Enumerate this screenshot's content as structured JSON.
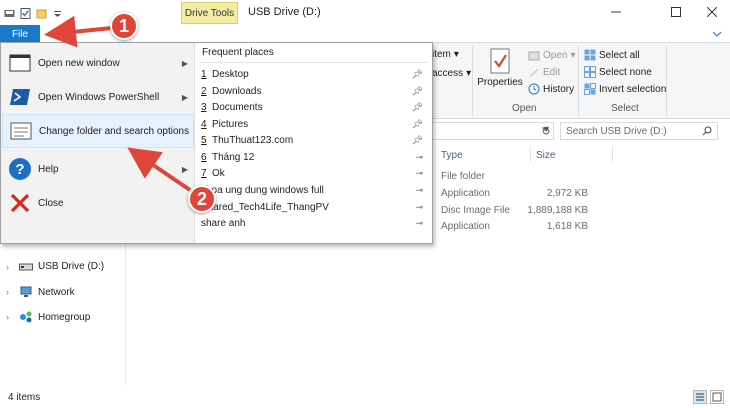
{
  "titlebar": {
    "title": "USB Drive (D:)",
    "contextual_tab": "Drive Tools",
    "qat_icons": [
      "save-icon",
      "properties-icon",
      "new-folder-icon",
      "customize-icon"
    ]
  },
  "ribbon": {
    "file_tab": "File",
    "open_group": {
      "properties": "Properties",
      "open": "Open",
      "edit": "Edit",
      "history": "History",
      "label": "Open"
    },
    "select_group": {
      "select_all": "Select all",
      "select_none": "Select none",
      "invert": "Invert selection",
      "label": "Select"
    },
    "partial": {
      "item": "item",
      "access": "access"
    }
  },
  "search": {
    "placeholder": "Search USB Drive (D:)"
  },
  "file_menu": {
    "items": [
      {
        "label": "Open new window",
        "icon": "new-window-icon",
        "arrow": true
      },
      {
        "label": "Open Windows PowerShell",
        "icon": "powershell-icon",
        "arrow": true
      },
      {
        "label": "Change folder and search options",
        "icon": "folder-options-icon",
        "arrow": false
      },
      {
        "label": "Help",
        "icon": "help-icon",
        "arrow": true
      },
      {
        "label": "Close",
        "icon": "close-icon",
        "arrow": false
      }
    ],
    "frequent_title": "Frequent places",
    "frequent": [
      {
        "num": "1",
        "name": "Desktop",
        "pinned": true
      },
      {
        "num": "2",
        "name": "Downloads",
        "pinned": true
      },
      {
        "num": "3",
        "name": "Documents",
        "pinned": true
      },
      {
        "num": "4",
        "name": "Pictures",
        "pinned": true
      },
      {
        "num": "5",
        "name": "ThuThuat123.com",
        "pinned": true
      },
      {
        "num": "6",
        "name": "Tháng 12",
        "pinned": false
      },
      {
        "num": "7",
        "name": "Ok",
        "pinned": false
      },
      {
        "num": "",
        "name": "khoa ung dung windows full",
        "pinned": false
      },
      {
        "num": "",
        "name": "Shared_Tech4Life_ThangPV",
        "pinned": false
      },
      {
        "num": "",
        "name": "share anh",
        "pinned": false
      }
    ]
  },
  "nav": {
    "items": [
      {
        "label": "USB Drive (D:)",
        "icon": "usb-drive-icon"
      },
      {
        "label": "Network",
        "icon": "network-icon"
      },
      {
        "label": "Homegroup",
        "icon": "homegroup-icon"
      }
    ]
  },
  "content": {
    "columns": [
      "Type",
      "Size"
    ],
    "rows": [
      {
        "type": "File folder",
        "size": ""
      },
      {
        "type": "Application",
        "size": "2,972 KB"
      },
      {
        "type": "Disc Image File",
        "size": "1,889,188 KB"
      },
      {
        "type": "Application",
        "size": "1,618 KB"
      }
    ]
  },
  "status": {
    "text": "4 items"
  },
  "annotations": {
    "badge1": "1",
    "badge2": "2",
    "arrow_color": "#e0453a"
  },
  "colors": {
    "accent": "#1979ca",
    "highlight": "#e5f1fb",
    "drive_tools": "#f5eba3"
  }
}
